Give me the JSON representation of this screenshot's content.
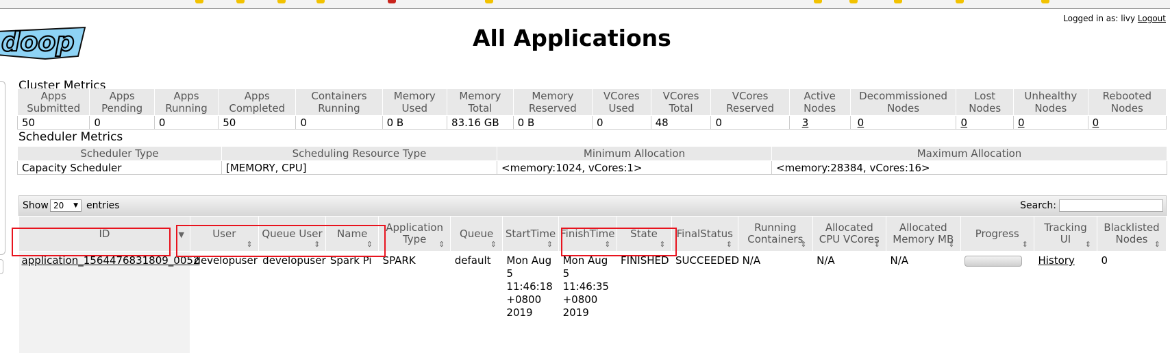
{
  "header": {
    "login_prefix": "Logged in as: livy",
    "logout_label": "Logout",
    "logo_text": "doop",
    "page_title": "All Applications"
  },
  "cluster": {
    "title": "Cluster Metrics",
    "headers": [
      [
        "Apps",
        "Submitted"
      ],
      [
        "Apps",
        "Pending"
      ],
      [
        "Apps",
        "Running"
      ],
      [
        "Apps",
        "Completed"
      ],
      [
        "Containers",
        "Running"
      ],
      [
        "Memory",
        "Used"
      ],
      [
        "Memory",
        "Total"
      ],
      [
        "Memory",
        "Reserved"
      ],
      [
        "VCores",
        "Used"
      ],
      [
        "VCores",
        "Total"
      ],
      [
        "VCores",
        "Reserved"
      ],
      [
        "Active",
        "Nodes"
      ],
      [
        "Decommissioned",
        "Nodes"
      ],
      [
        "Lost",
        "Nodes"
      ],
      [
        "Unhealthy",
        "Nodes"
      ],
      [
        "Rebooted",
        "Nodes"
      ]
    ],
    "values": [
      "50",
      "0",
      "0",
      "50",
      "0",
      "0 B",
      "83.16 GB",
      "0 B",
      "0",
      "48",
      "0",
      "3",
      "0",
      "0",
      "0",
      "0"
    ]
  },
  "scheduler": {
    "title": "Scheduler Metrics",
    "headers": [
      "Scheduler Type",
      "Scheduling Resource Type",
      "Minimum Allocation",
      "Maximum Allocation"
    ],
    "values": [
      "Capacity Scheduler",
      "[MEMORY, CPU]",
      "<memory:1024, vCores:1>",
      "<memory:28384, vCores:16>"
    ]
  },
  "controls": {
    "show_label": "Show",
    "page_length": "20",
    "entries_label": "entries",
    "search_label": "Search:",
    "search_value": ""
  },
  "apps": {
    "headers": [
      [
        "ID"
      ],
      [
        "User"
      ],
      [
        "Queue User"
      ],
      [
        "Name"
      ],
      [
        "Application",
        "Type"
      ],
      [
        "Queue"
      ],
      [
        "StartTime"
      ],
      [
        "FinishTime"
      ],
      [
        "State"
      ],
      [
        "FinalStatus"
      ],
      [
        "Running",
        "Containers"
      ],
      [
        "Allocated",
        "CPU VCores"
      ],
      [
        "Allocated",
        "Memory MB"
      ],
      [
        "Progress"
      ],
      [
        "Tracking",
        "UI"
      ],
      [
        "Blacklisted",
        "Nodes"
      ]
    ],
    "rows": [
      {
        "id": "application_1564476831809_0052",
        "user": "developuser",
        "queue_user": "developuser",
        "name": "Spark Pi",
        "type": "SPARK",
        "queue": "default",
        "start_lines": [
          "Mon Aug",
          "5",
          "11:46:18",
          "+0800",
          "2019"
        ],
        "finish_lines": [
          "Mon Aug",
          "5 11:46:35",
          "+0800",
          "2019"
        ],
        "state": "FINISHED",
        "final_status": "SUCCEEDED",
        "running_containers": "N/A",
        "alloc_vcores": "N/A",
        "alloc_memory": "N/A",
        "progress": 1.0,
        "tracking_ui": "History",
        "blacklisted": "0"
      }
    ]
  },
  "colors": {
    "highlight": "#e8131e",
    "header_bg": "#e8e8e8",
    "logo_blue": "#8ed3f5"
  }
}
